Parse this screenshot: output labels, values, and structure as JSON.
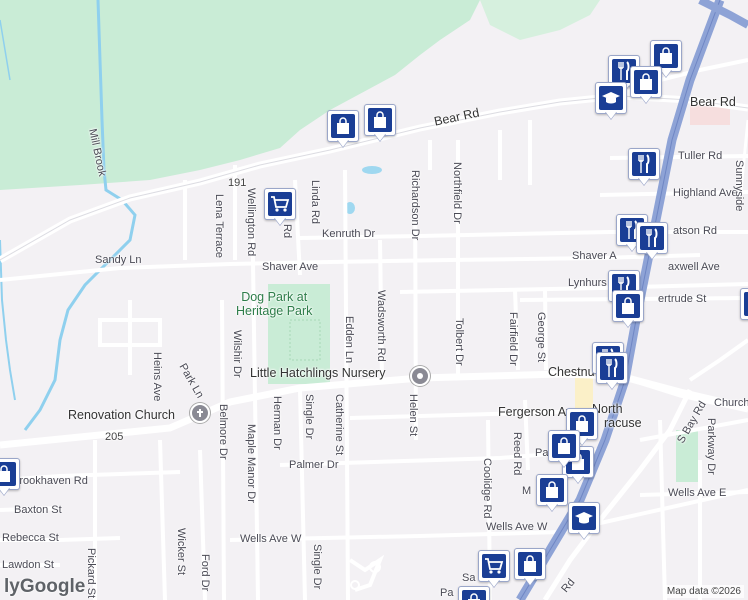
{
  "labels": {
    "bear_rd": "Bear Rd",
    "bear_rd_east": "Bear Rd",
    "route_191": "191",
    "mill_brook": "Mill Brook",
    "tuller_rd": "Tuller Rd",
    "highland_ave": "Highland Ave",
    "atson_rd": "atson Rd",
    "shaver_ave_w": "Shaver Ave",
    "shaver_ave_e": "Shaver A",
    "maxwell_ave": "axwell Ave",
    "lynhurst": "Lynhurs",
    "gertrude_st": "ertrude St",
    "kenruth_dr": "Kenruth Dr",
    "sandy_ln": "Sandy Ln",
    "lena_terrace": "Lena Terrace",
    "wellington_rd": "Wellington Rd",
    "linda_rd": "Linda Rd",
    "rd_fragment": "Rd",
    "richardson_dr": "Richardson Dr",
    "northfield_dr": "Northfield Dr",
    "wadsworth_rd": "Wadsworth Rd",
    "edden_ln": "Edden Ln",
    "tolbert_dr": "Tolbert Dr",
    "fairfield_dr": "Fairfield Dr",
    "george_st": "George St",
    "chestnut": "Chestnu",
    "heins_ave": "Heins Ave",
    "park_ln": "Park Ln",
    "wilshir_dr": "Wilshir Dr",
    "church": "Church",
    "s_bay_rd": "S Bay Rd",
    "parkway_dr": "Parkway Dr",
    "renovation_church": "Renovation Church",
    "route_205": "205",
    "belmore_dr": "Belmore Dr",
    "herman_dr": "Herman Dr",
    "maple_manor_dr": "Maple Manor Dr",
    "single_dr": "Single Dr",
    "single_dr_2": "Single Dr",
    "catherine_st": "Catherine St",
    "helen_st": "Helen St",
    "fergerson_ave": "Fergerson Av",
    "reed_rd": "Reed Rd",
    "coolidge_rd": "Coolidge Rd",
    "palmer_dr": "Palmer Dr",
    "pa_fragment": "Pa",
    "m_fragment": "M",
    "brookhaven_rd": "Brookhaven Rd",
    "baxton_st": "Baxton St",
    "rebecca_st": "Rebecca St",
    "lawdon_st": "Lawdon St",
    "wicker_st": "Wicker St",
    "pickard_st": "Pickard St",
    "ford_dr": "Ford Dr",
    "wells_ave_w": "Wells Ave W",
    "wells_ave_w_2": "Wells Ave W",
    "wells_ave_e": "Wells Ave E",
    "sa_fragment": "Sa",
    "pa_fragment_2": "Pa",
    "s_rd": "Rd",
    "sunnyside": "Sunnyside",
    "north_syracuse_1": "North",
    "north_syracuse_2": "racuse",
    "dog_park_1": "Dog Park at",
    "dog_park_2": "Heritage Park",
    "little_hatchlings": "Little Hatchlings Nursery",
    "ly_fragment": "ly"
  },
  "attribution": {
    "logo": "Google",
    "map_data": "Map data ©2026"
  },
  "markers": [
    {
      "id": "shopping-bag-bear-rd-1",
      "icon": "shopping-bag-icon"
    },
    {
      "id": "shopping-bag-bear-rd-2",
      "icon": "shopping-bag-icon"
    },
    {
      "id": "shopping-cart-linda",
      "icon": "shopping-cart-icon"
    },
    {
      "id": "restaurant-ne-1",
      "icon": "restaurant-icon"
    },
    {
      "id": "shopping-bag-ne-1",
      "icon": "shopping-bag-icon"
    },
    {
      "id": "shopping-bag-ne-2",
      "icon": "shopping-bag-icon"
    },
    {
      "id": "school-ne",
      "icon": "school-icon"
    },
    {
      "id": "restaurant-tuller",
      "icon": "restaurant-icon"
    },
    {
      "id": "restaurant-atson-1",
      "icon": "restaurant-icon"
    },
    {
      "id": "restaurant-atson-2",
      "icon": "restaurant-icon"
    },
    {
      "id": "restaurant-maxwell",
      "icon": "restaurant-icon"
    },
    {
      "id": "shopping-bag-gertrude",
      "icon": "shopping-bag-icon"
    },
    {
      "id": "restaurant-chestnut-1",
      "icon": "restaurant-icon"
    },
    {
      "id": "restaurant-chestnut-2",
      "icon": "restaurant-icon"
    },
    {
      "id": "shopping-bag-north-1",
      "icon": "shopping-bag-icon"
    },
    {
      "id": "shopping-bag-north-2",
      "icon": "shopping-bag-icon"
    },
    {
      "id": "shopping-bag-palmer",
      "icon": "shopping-bag-icon"
    },
    {
      "id": "shopping-bag-m",
      "icon": "shopping-bag-icon"
    },
    {
      "id": "school-wells",
      "icon": "school-icon"
    },
    {
      "id": "shopping-cart-south",
      "icon": "shopping-cart-icon"
    },
    {
      "id": "shopping-bag-south",
      "icon": "shopping-bag-icon"
    },
    {
      "id": "shopping-bag-bottom",
      "icon": "shopping-bag-icon"
    },
    {
      "id": "edge-left-marker",
      "icon": "shopping-bag-icon"
    },
    {
      "id": "edge-right-marker",
      "icon": "shopping-bag-icon"
    }
  ]
}
